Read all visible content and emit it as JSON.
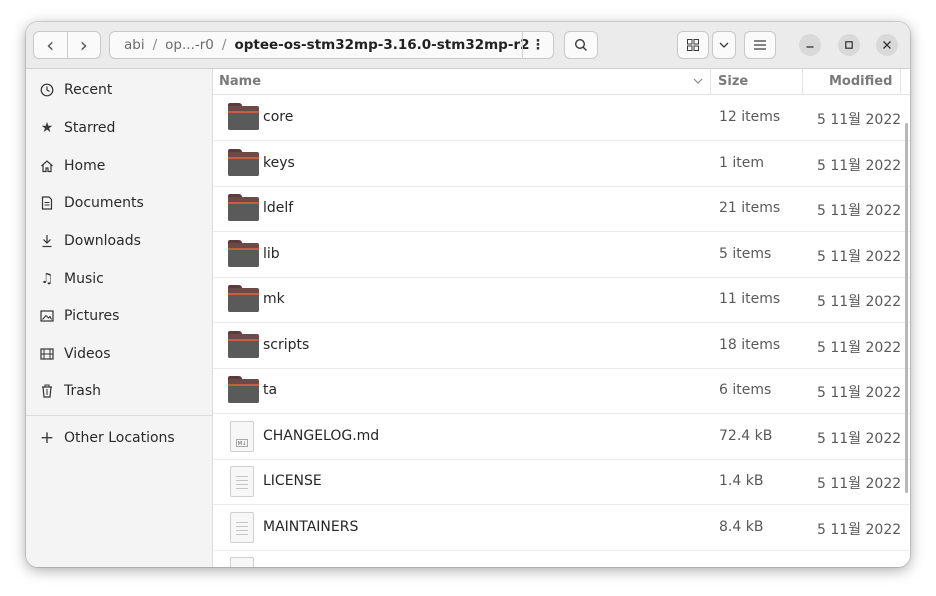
{
  "path": {
    "seg1": "abi",
    "seg2": "op...",
    "seg3": "-r0",
    "current": "optee-os-stm32mp-3.16.0-stm32mp-r2",
    "menu_glyph": "⋮"
  },
  "toolbar": {
    "back_glyph": "‹",
    "forward_glyph": "›",
    "search_glyph": "⌕",
    "view_grid_glyph": "⊞",
    "view_dropdown_glyph": "⌄",
    "list_menu_glyph": "≡",
    "minimize_glyph": "–",
    "maximize_glyph": "□",
    "close_glyph": "✕"
  },
  "sidebar": {
    "items": [
      {
        "label": "Recent",
        "icon": "clock-icon",
        "glyph": "◷"
      },
      {
        "label": "Starred",
        "icon": "star-icon",
        "glyph": "★"
      },
      {
        "label": "Home",
        "icon": "home-icon",
        "glyph": "⌂"
      },
      {
        "label": "Documents",
        "icon": "document-icon",
        "glyph": "🗎"
      },
      {
        "label": "Downloads",
        "icon": "download-icon",
        "glyph": "⤓"
      },
      {
        "label": "Music",
        "icon": "music-icon",
        "glyph": "♫"
      },
      {
        "label": "Pictures",
        "icon": "picture-icon",
        "glyph": "▣"
      },
      {
        "label": "Videos",
        "icon": "video-icon",
        "glyph": "▤"
      },
      {
        "label": "Trash",
        "icon": "trash-icon",
        "glyph": "🗑"
      }
    ],
    "other": {
      "label": "Other Locations",
      "glyph": "+"
    }
  },
  "columns": {
    "name": "Name",
    "size": "Size",
    "modified": "Modified",
    "sort_glyph": "⌄"
  },
  "files": [
    {
      "name": "core",
      "size": "12 items",
      "modified": "5 11월 2022",
      "kind": "folder"
    },
    {
      "name": "keys",
      "size": "1 item",
      "modified": "5 11월 2022",
      "kind": "folder"
    },
    {
      "name": "ldelf",
      "size": "21 items",
      "modified": "5 11월 2022",
      "kind": "folder"
    },
    {
      "name": "lib",
      "size": "5 items",
      "modified": "5 11월 2022",
      "kind": "folder"
    },
    {
      "name": "mk",
      "size": "11 items",
      "modified": "5 11월 2022",
      "kind": "folder"
    },
    {
      "name": "scripts",
      "size": "18 items",
      "modified": "5 11월 2022",
      "kind": "folder"
    },
    {
      "name": "ta",
      "size": "6 items",
      "modified": "5 11월 2022",
      "kind": "folder"
    },
    {
      "name": "CHANGELOG.md",
      "size": "72.4 kB",
      "modified": "5 11월 2022",
      "kind": "markdown"
    },
    {
      "name": "LICENSE",
      "size": "1.4 kB",
      "modified": "5 11월 2022",
      "kind": "text"
    },
    {
      "name": "MAINTAINERS",
      "size": "8.4 kB",
      "modified": "5 11월 2022",
      "kind": "text"
    }
  ],
  "colors": {
    "folder_accent": "#c65f42",
    "folder_body": "#5a5a5a",
    "headerbar": "#ebebeb",
    "sidebar": "#f4f4f4"
  }
}
